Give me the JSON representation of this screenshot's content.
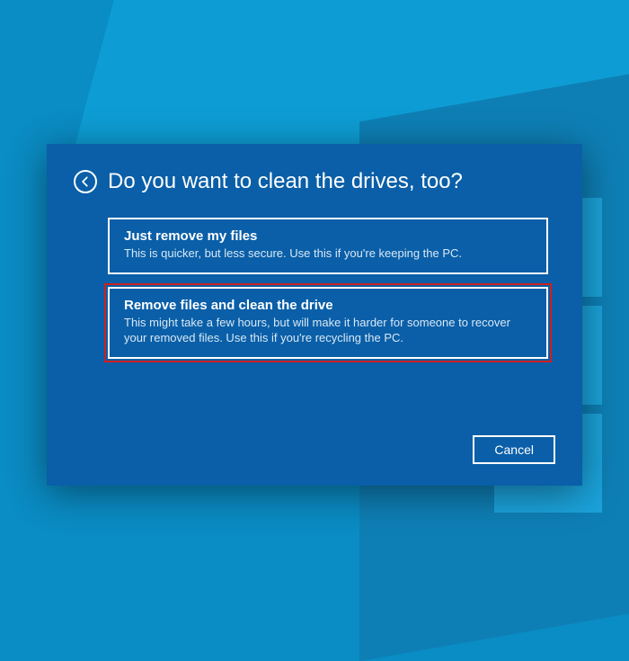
{
  "dialog": {
    "title": "Do you want to clean the drives, too?",
    "options": [
      {
        "title": "Just remove my files",
        "description": "This is quicker, but less secure. Use this if you're keeping the PC."
      },
      {
        "title": "Remove files and clean the drive",
        "description": "This might take a few hours, but will make it harder for someone to recover your removed files. Use this if you're recycling the PC."
      }
    ],
    "cancel_label": "Cancel"
  }
}
